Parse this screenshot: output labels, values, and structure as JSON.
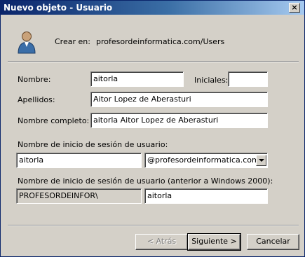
{
  "window": {
    "title": "Nuevo objeto - Usuario",
    "close_glyph": "×"
  },
  "header": {
    "icon": "user-icon",
    "create_in_label": "Crear en:",
    "create_in_path": "profesordeinformatica.com/Users"
  },
  "form": {
    "first_name_label": "Nombre:",
    "first_name_value": "aitorla",
    "initials_label": "Iniciales:",
    "initials_value": "",
    "last_name_label": "Apellidos:",
    "last_name_value": "Aitor Lopez de Aberasturi",
    "full_name_label": "Nombre completo:",
    "full_name_value": "aitorla Aitor Lopez de Aberasturi",
    "logon_label": "Nombre de inicio de sesión de usuario:",
    "logon_value": "aitorla",
    "domain_value": "@profesordeinformatica.com",
    "legacy_logon_label": "Nombre de inicio de sesión de usuario (anterior a Windows 2000):",
    "legacy_domain_value": "PROFESORDEINFOR\\",
    "legacy_logon_value": "aitorla"
  },
  "buttons": {
    "back": "< Atrás",
    "next": "Siguiente >",
    "cancel": "Cancelar"
  }
}
